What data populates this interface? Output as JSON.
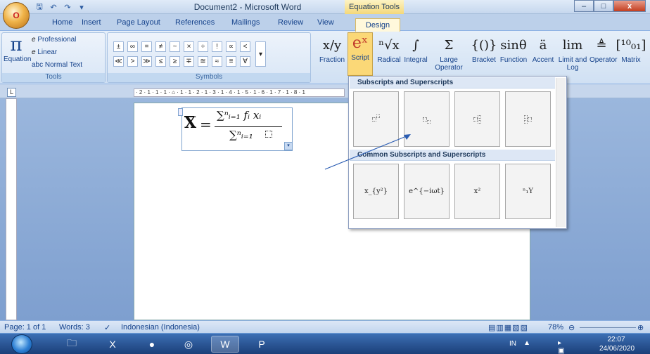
{
  "title_bar": {
    "office_button": "O",
    "qat": [
      "save-icon",
      "undo-icon",
      "redo-icon",
      "customize-icon"
    ],
    "doc_title": "Document2 - Microsoft Word",
    "context_header": "Equation Tools",
    "win_min": "–",
    "win_max": "□",
    "win_close": "x"
  },
  "tabs": [
    "Home",
    "Insert",
    "Page Layout",
    "References",
    "Mailings",
    "Review",
    "View",
    "Design"
  ],
  "ribbon": {
    "tools": {
      "equation": "Equation",
      "professional": "Professional",
      "linear": "Linear",
      "normal_text": "abc Normal Text",
      "label": "Tools"
    },
    "symbols": {
      "row1": [
        "±",
        "∞",
        "=",
        "≠",
        "~",
        "×",
        "÷",
        "!",
        "∝",
        "<"
      ],
      "row2": [
        "≪",
        ">",
        "≫",
        "≤",
        "≥",
        "∓",
        "≅",
        "≈",
        "≡",
        "∀"
      ],
      "label": "Symbols"
    },
    "structures": [
      {
        "icon": "x/y",
        "label": "Fraction"
      },
      {
        "icon": "eˣ",
        "label": "Script"
      },
      {
        "icon": "ⁿ√x",
        "label": "Radical"
      },
      {
        "icon": "∫",
        "label": "Integral"
      },
      {
        "icon": "Σ",
        "label": "Large Operator"
      },
      {
        "icon": "{()}",
        "label": "Bracket"
      },
      {
        "icon": "sinθ",
        "label": "Function"
      },
      {
        "icon": "ä",
        "label": "Accent"
      },
      {
        "icon": "lim",
        "label": "Limit and Log"
      },
      {
        "icon": "≜",
        "label": "Operator"
      },
      {
        "icon": "[¹⁰₀₁]",
        "label": "Matrix"
      }
    ]
  },
  "equation": {
    "lhs": "X",
    "eq": "=",
    "numerator": "∑ⁿᵢ₌₁ fᵢ xᵢ",
    "denominator": "∑ⁿᵢ₌₁"
  },
  "dropdown": {
    "section1": "Subscripts and Superscripts",
    "section2": "Common Subscripts and Superscripts",
    "common": [
      "x_{y²}",
      "e^{−iωt}",
      "x²",
      "ⁿ₁Y"
    ]
  },
  "status": {
    "page": "Page: 1 of 1",
    "words": "Words: 3",
    "language": "Indonesian (Indonesia)",
    "zoom": "78%"
  },
  "tray": {
    "lang": "IN",
    "time": "22:07",
    "date": "24/06/2020"
  }
}
